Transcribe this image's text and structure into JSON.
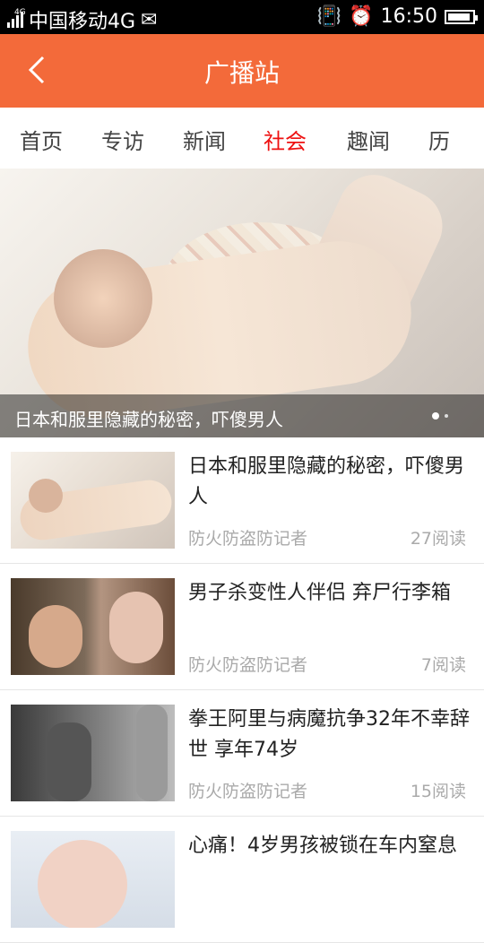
{
  "status_bar": {
    "network_type": "4G",
    "carrier": "中国移动4G",
    "time": "16:50"
  },
  "title_bar": {
    "title": "广播站",
    "accent_color": "#f36a3a"
  },
  "tabs": [
    {
      "label": "首页",
      "active": false
    },
    {
      "label": "专访",
      "active": false
    },
    {
      "label": "新闻",
      "active": false
    },
    {
      "label": "社会",
      "active": true
    },
    {
      "label": "趣闻",
      "active": false
    },
    {
      "label": "历",
      "active": false
    }
  ],
  "banner": {
    "caption": "日本和服里隐藏的秘密，吓傻男人"
  },
  "articles": [
    {
      "title": "日本和服里隐藏的秘密，吓傻男人",
      "author": "防火防盗防记者",
      "reads": "27阅读"
    },
    {
      "title": "男子杀变性人伴侣 弃尸行李箱",
      "author": "防火防盗防记者",
      "reads": "7阅读"
    },
    {
      "title": "拳王阿里与病魔抗争32年不幸辞世 享年74岁",
      "author": "防火防盗防记者",
      "reads": "15阅读"
    },
    {
      "title": "心痛！4岁男孩被锁在车内窒息",
      "author": "",
      "reads": ""
    }
  ]
}
